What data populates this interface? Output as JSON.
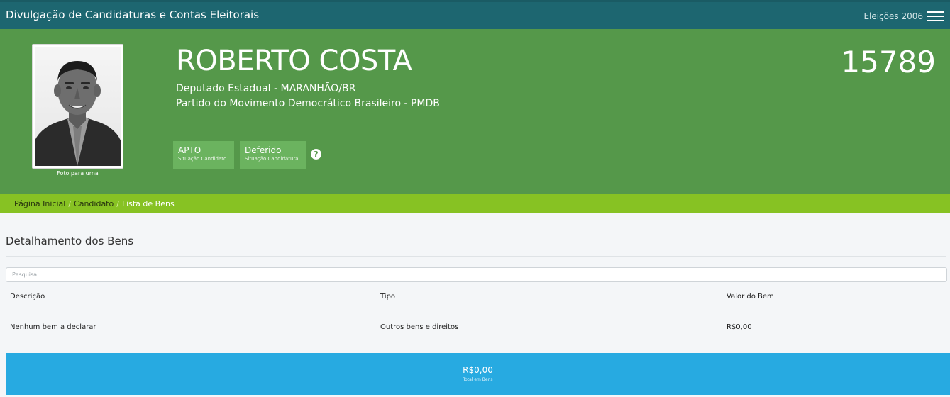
{
  "header": {
    "title": "Divulgação de Candidaturas e Contas Eleitorais",
    "election": "Eleições 2006",
    "menu_icon": "hamburger-menu-icon"
  },
  "candidate": {
    "name": "ROBERTO COSTA",
    "number": "15789",
    "office": "Deputado Estadual - MARANHÃO/BR",
    "party": "Partido do Movimento Democrático Brasileiro - PMDB",
    "photo_caption": "Foto para urna",
    "status": [
      {
        "value": "APTO",
        "label": "Situação Candidato"
      },
      {
        "value": "Deferido",
        "label": "Situação Candidatura"
      }
    ],
    "help_icon": "question-circle-icon"
  },
  "breadcrumb": {
    "items": [
      "Página Inicial",
      "Candidato",
      "Lista de Bens"
    ],
    "separator": "/"
  },
  "assets": {
    "title": "Detalhamento dos Bens",
    "search_placeholder": "Pesquisa",
    "columns": [
      "Descrição",
      "Tipo",
      "Valor do Bem"
    ],
    "rows": [
      {
        "description": "Nenhum bem a declarar",
        "type": "Outros bens e direitos",
        "value": "R$0,00"
      }
    ],
    "total_value": "R$0,00",
    "total_label": "Total em Bens"
  },
  "colors": {
    "topbar": "#1d6670",
    "hero": "#55984a",
    "status_box": "#6bb35f",
    "breadcrumb": "#87c223",
    "total_bar": "#27aae1"
  }
}
